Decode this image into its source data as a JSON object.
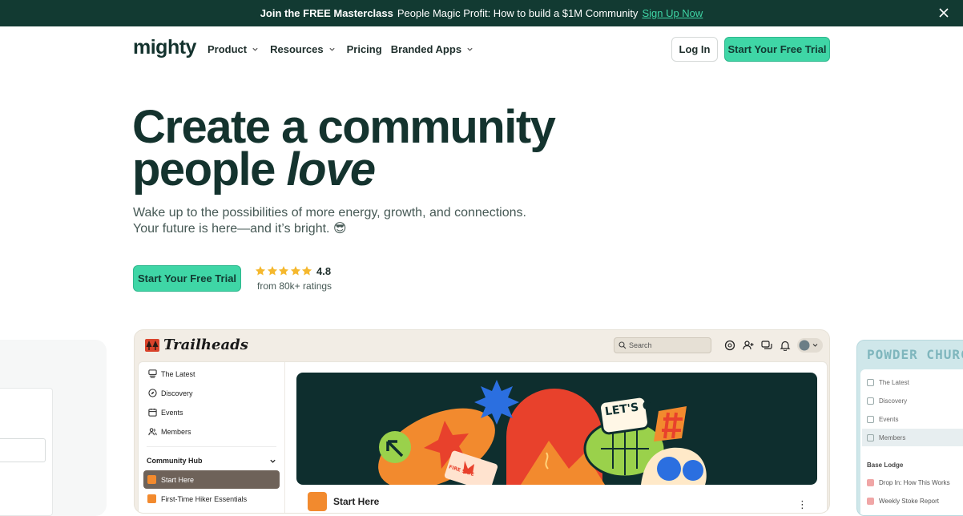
{
  "banner": {
    "bold": "Join the FREE Masterclass",
    "text": "People Magic Profit: How to build a $1M Community",
    "link": "Sign Up Now"
  },
  "nav": {
    "logo": "mighty",
    "items": [
      {
        "label": "Product",
        "has_menu": true
      },
      {
        "label": "Resources",
        "has_menu": true
      },
      {
        "label": "Pricing",
        "has_menu": false
      },
      {
        "label": "Branded Apps",
        "has_menu": true
      }
    ],
    "login": "Log In",
    "trial": "Start Your Free Trial"
  },
  "hero": {
    "line1": "Create a community",
    "line2_plain": "people",
    "line2_italic": "love",
    "subtitle": "Wake up to the possibilities of more energy, growth, and connections. Your future is here—and it’s bright. 😎",
    "cta": "Start Your Free Trial",
    "rating": "4.8",
    "stars": 5,
    "ratings_count": "from 80k+ ratings"
  },
  "mockup": {
    "brand": "Trailheads",
    "search_placeholder": "Search",
    "sidebar": [
      {
        "label": "The Latest",
        "icon": "feed-icon"
      },
      {
        "label": "Discovery",
        "icon": "compass-icon"
      },
      {
        "label": "Events",
        "icon": "calendar-icon"
      },
      {
        "label": "Members",
        "icon": "members-icon"
      }
    ],
    "section": "Community Hub",
    "selected": "Start Here",
    "item": "First-Time Hiker Essentials",
    "post_title": "Start Here",
    "art_text": "LET'S GO",
    "sticker_text": "FIRE SIDE"
  },
  "right_mockup": {
    "brand": "POWDER CHURCH",
    "items": [
      "The Latest",
      "Discovery",
      "Events",
      "Members"
    ],
    "section": "Base Lodge",
    "rows": [
      "Drop In: How This Works",
      "Weekly Stoke Report"
    ]
  },
  "colors": {
    "banner_bg": "#123a32",
    "accent": "#3fd6a6",
    "heading": "#14332e",
    "star": "#f5b82e"
  }
}
